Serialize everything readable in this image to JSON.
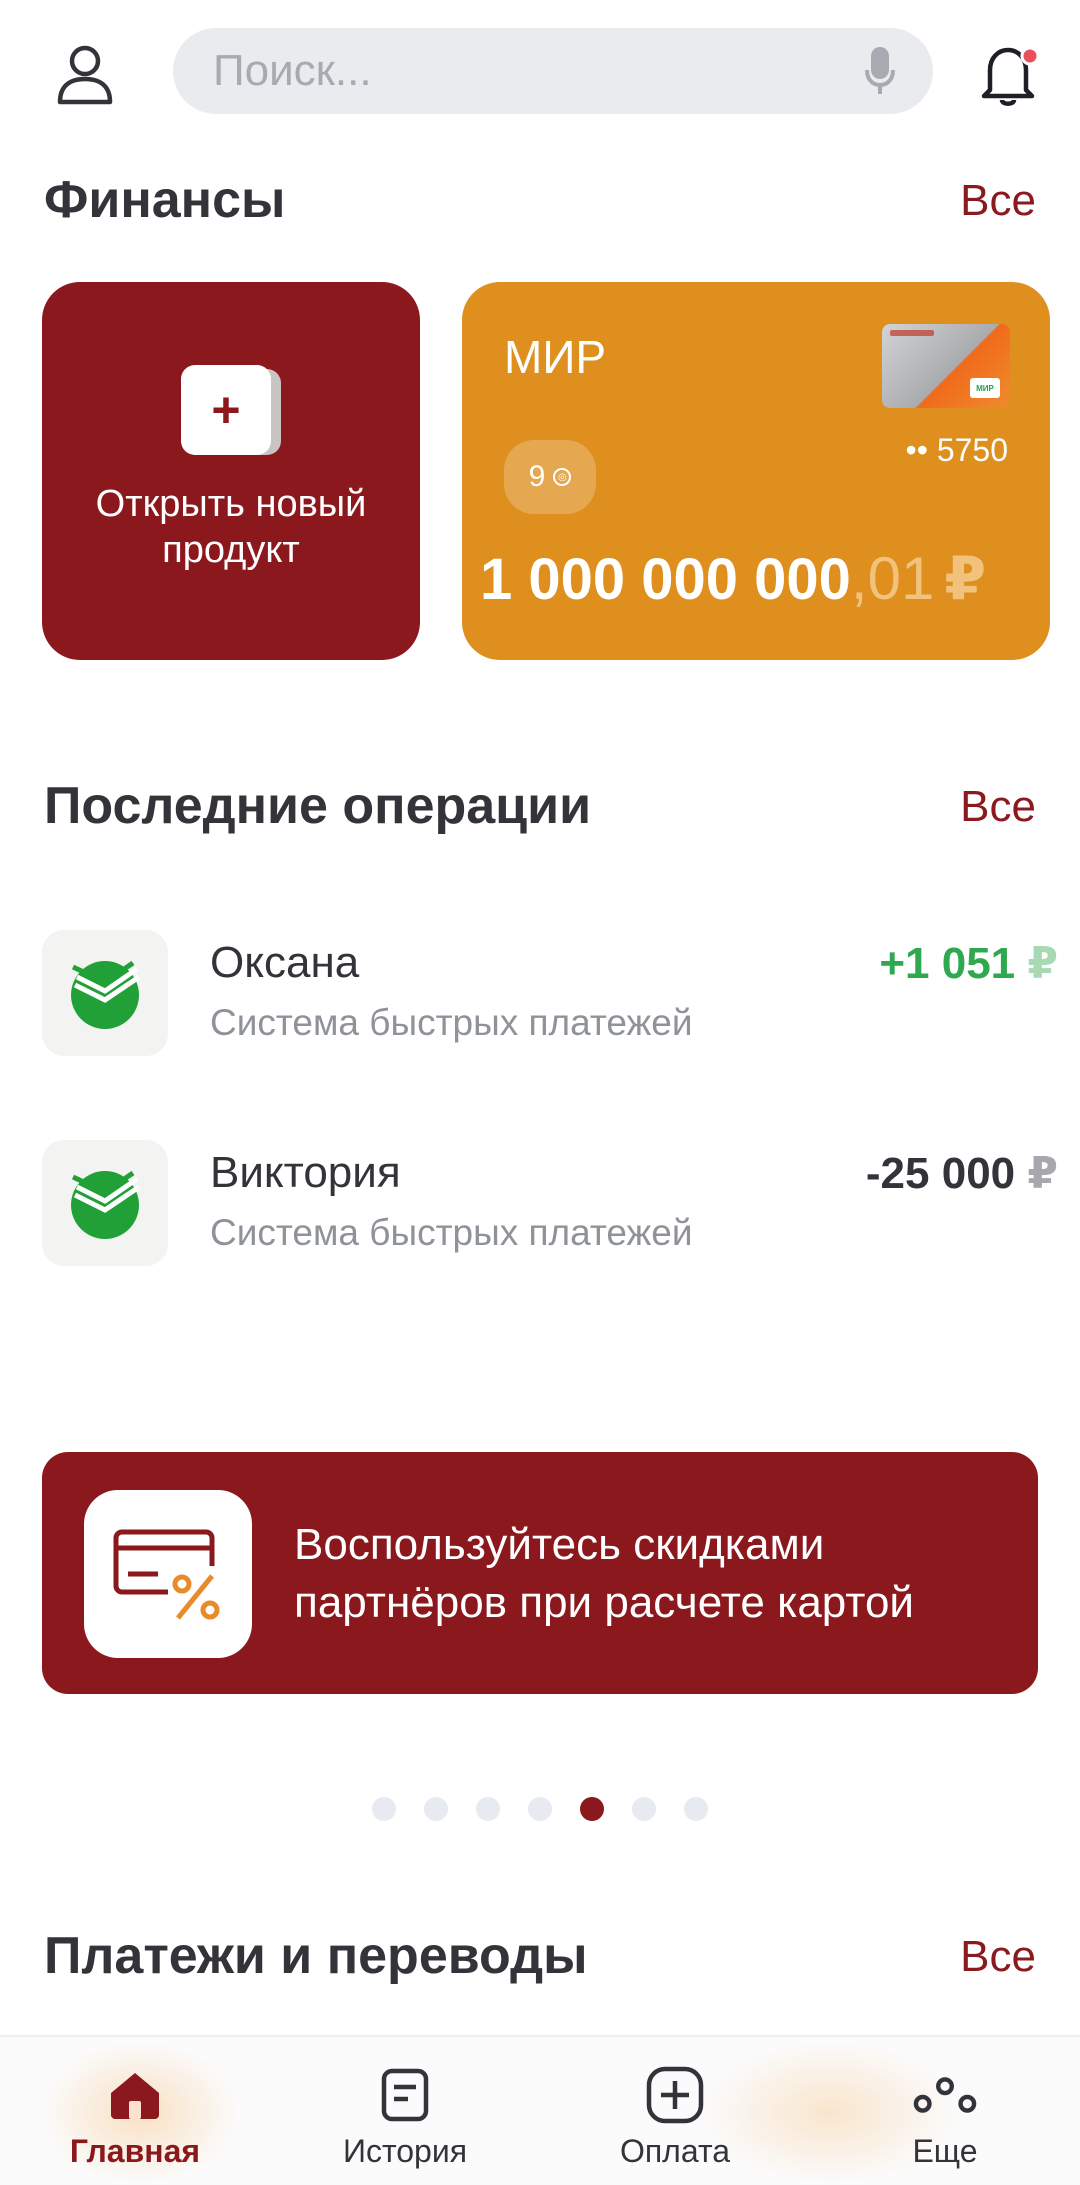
{
  "header": {
    "search_placeholder": "Поиск...",
    "profile_icon": "person-icon",
    "mic_icon": "mic-icon",
    "bell_icon": "bell-icon",
    "notification_dot_color": "#e8505b"
  },
  "finance": {
    "title": "Финансы",
    "all_label": "Все",
    "new_product": {
      "plus": "+",
      "label": "Открыть новый продукт"
    },
    "card": {
      "name": "МИР",
      "bonus": "9",
      "number": "•• 5750",
      "balance_int": "1 000 000 000",
      "balance_frac": ",01",
      "currency": "₽",
      "mini_logo": "МИР",
      "color": "#de8f1e"
    }
  },
  "operations": {
    "title": "Последние операции",
    "all_label": "Все",
    "items": [
      {
        "name": "Оксана",
        "desc": "Система быстрых платежей",
        "amount": "+1 051",
        "currency": "₽",
        "direction": "in",
        "icon": "sber-logo-icon"
      },
      {
        "name": "Виктория",
        "desc": "Система быстрых платежей",
        "amount": "-25 000",
        "currency": "₽",
        "direction": "out",
        "icon": "sber-logo-icon"
      }
    ]
  },
  "promo": {
    "text": "Воспользуйтесь скидками партнёров при расчете картой",
    "icon": "card-discount-icon"
  },
  "pager": {
    "count": 7,
    "active_index": 4
  },
  "payments": {
    "title": "Платежи и переводы",
    "all_label": "Все"
  },
  "bottom_nav": {
    "items": [
      {
        "label": "Главная",
        "icon": "home-icon",
        "active": true
      },
      {
        "label": "История",
        "icon": "history-icon",
        "active": false
      },
      {
        "label": "Оплата",
        "icon": "payment-plus-icon",
        "active": false
      },
      {
        "label": "Еще",
        "icon": "more-icon",
        "active": false
      }
    ]
  },
  "colors": {
    "brand": "#8b181d",
    "positive": "#2fa84f",
    "text": "#33343a",
    "muted": "#8f9399"
  }
}
